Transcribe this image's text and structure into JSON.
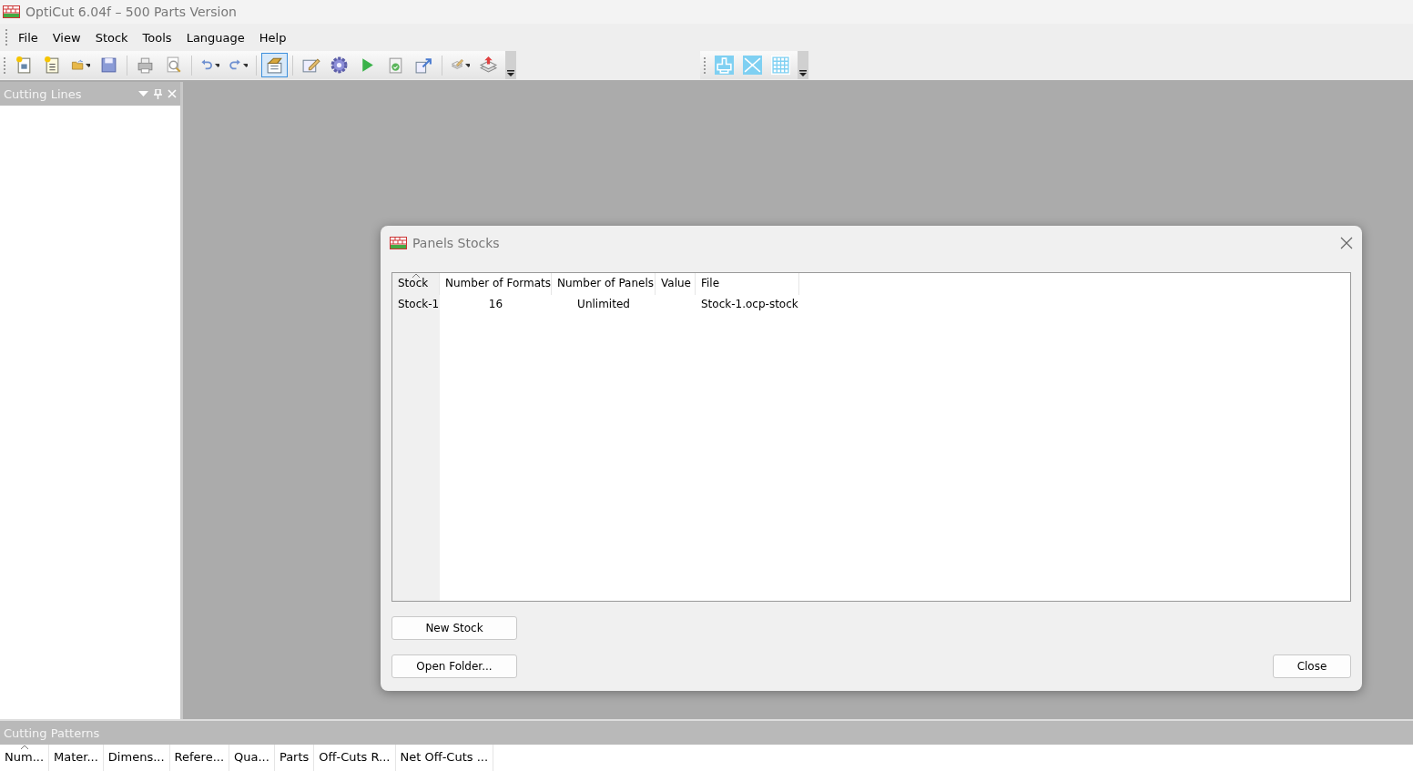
{
  "window": {
    "title": "OptiCut 6.04f – 500 Parts Version"
  },
  "menu": [
    "File",
    "View",
    "Stock",
    "Tools",
    "Language",
    "Help"
  ],
  "toolbar": [
    {
      "kind": "new",
      "selected": false
    },
    {
      "kind": "newdoc",
      "selected": false
    },
    {
      "kind": "open",
      "selected": false,
      "dropdown": true
    },
    {
      "kind": "save",
      "selected": false
    },
    {
      "kind": "sep"
    },
    {
      "kind": "print",
      "selected": false
    },
    {
      "kind": "preview",
      "selected": false
    },
    {
      "kind": "sep"
    },
    {
      "kind": "undo",
      "selected": false,
      "dropdown": true
    },
    {
      "kind": "redo",
      "selected": false,
      "dropdown": true
    },
    {
      "kind": "sep"
    },
    {
      "kind": "stock",
      "selected": true
    },
    {
      "kind": "sep"
    },
    {
      "kind": "edit",
      "selected": false
    },
    {
      "kind": "gear",
      "selected": false
    },
    {
      "kind": "play",
      "selected": false
    },
    {
      "kind": "check",
      "selected": false
    },
    {
      "kind": "export",
      "selected": false
    },
    {
      "kind": "sep"
    },
    {
      "kind": "layers",
      "selected": false,
      "dropdown": true
    },
    {
      "kind": "layersup",
      "selected": false
    }
  ],
  "toolbar2": [
    {
      "kind": "plot",
      "selected": false
    },
    {
      "kind": "cut",
      "selected": false
    },
    {
      "kind": "grid",
      "selected": false
    }
  ],
  "left_panel": {
    "title": "Cutting Lines"
  },
  "dialog": {
    "title": "Panels Stocks",
    "table": {
      "columns": [
        "Stock",
        "Number of Formats",
        "Number of Panels",
        "Value",
        "File"
      ],
      "rows": [
        [
          "Stock-1",
          "16",
          "Unlimited",
          "",
          "Stock-1.ocp-stock"
        ]
      ]
    },
    "buttons_left": [
      "New Stock",
      "Open Folder..."
    ],
    "close_button": "Close"
  },
  "bottom_panel": {
    "title": "Cutting Patterns",
    "columns": [
      "Num...",
      "Mater...",
      "Dimens...",
      "Refere...",
      "Qua...",
      "Parts",
      "Off-Cuts R...",
      "Net Off-Cuts ..."
    ]
  }
}
